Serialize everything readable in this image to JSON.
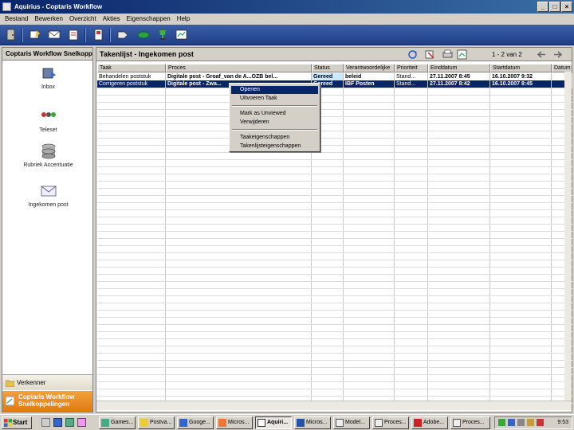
{
  "window": {
    "title": "Aquirius - Coptaris Workflow",
    "controls": [
      "_",
      "□",
      "×"
    ]
  },
  "menu": [
    "Bestand",
    "Bewerken",
    "Overzicht",
    "Akties",
    "Eigenschappen",
    "Help"
  ],
  "toolbar": {
    "icons": [
      "door-icon",
      "note-icon",
      "envelope-icon",
      "document-icon",
      "flag-icon",
      "tag-icon",
      "leaf-icon",
      "trophy-icon",
      "chart-icon"
    ]
  },
  "left_pane": {
    "title": "Coptaris Workflow Snelkoppelingen",
    "shortcuts": [
      {
        "label": "Inbox",
        "icon": "inbox-icon"
      },
      {
        "label": "Teleset",
        "icon": "teleset-icon"
      },
      {
        "label": "Rubriek Accentuatie",
        "icon": "database-icon"
      },
      {
        "label": "Ingekomen post",
        "icon": "mail-icon"
      }
    ],
    "nav": [
      {
        "label": "Verkenner",
        "icon": "folder-icon"
      },
      {
        "label": "Coptaris Workflow Snelkoppelingen",
        "icon": "shortcut-icon"
      }
    ]
  },
  "right_pane": {
    "title": "Takenlijst - Ingekomen post",
    "paging": "1 - 2 van 2",
    "icons": [
      "refresh-icon",
      "filter-icon",
      "print-icon",
      "export-icon",
      "back-arrow-icon",
      "forward-arrow-icon"
    ]
  },
  "table": {
    "columns": [
      "Taak",
      "Proces",
      "Status",
      "Verantwoordelijke",
      "Prioriteit",
      "Einddatum",
      "Startdatum",
      "Datum"
    ],
    "rows": [
      [
        "Behandelen poststuk",
        "Digitale post - Groaf_van de A...OZB bel...",
        "Gereed",
        "beleid",
        "Stand...",
        "27.11.2007 8:45",
        "16.10.2007 9:32",
        ""
      ],
      [
        "Corrigeren poststuk",
        "Digitale post - Zwa...",
        "Gereed",
        "IBF Posten",
        "Stand...",
        "27.11.2007 8:42",
        "16.10.2007 8:45",
        ""
      ]
    ]
  },
  "context_menu": {
    "items": [
      {
        "label": "Openen",
        "selected": true
      },
      {
        "label": "Uitvoeren Taak"
      },
      {
        "separator": true
      },
      {
        "label": "Mark as Unviewed"
      },
      {
        "label": "Verwijderen"
      },
      {
        "separator": true
      },
      {
        "label": "Taakeigenschappen"
      },
      {
        "label": "Takenlijsteigenschappen"
      }
    ]
  },
  "taskbar": {
    "start_label": "Start",
    "tasks": [
      "Games...",
      "Postva...",
      "Googe...",
      "Micros...",
      "Aquiri...",
      "Micros...",
      "Model...",
      "Proces...",
      "Adobe...",
      "Proces..."
    ],
    "active_task": 4,
    "clock": "9:53"
  },
  "colors": {
    "title_bar": "#0a246a",
    "toolbar": "#2b4f9c",
    "selection": "#0a246a",
    "snelkoppelingen_tab": "#e88a20"
  }
}
